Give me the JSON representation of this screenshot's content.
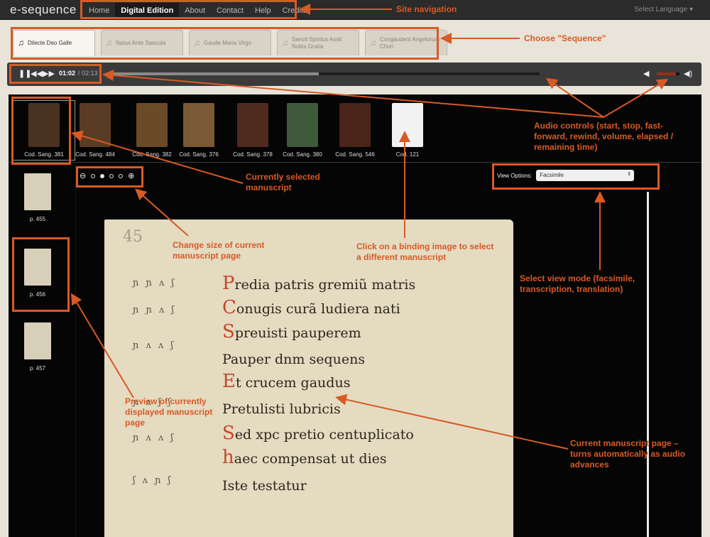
{
  "brand": "e-sequence",
  "nav": [
    "Home",
    "Digital Edition",
    "About",
    "Contact",
    "Help",
    "Credits"
  ],
  "nav_active": "Digital Edition",
  "language": "Select Language",
  "tabs": [
    {
      "label": "Dilecte Deo Galle",
      "active": true
    },
    {
      "label": "Natus Ante Saecula",
      "active": false
    },
    {
      "label": "Gaude Maria Virgo",
      "active": false
    },
    {
      "label": "Sancti Spiritus Assit Nobis Gratia",
      "active": false
    },
    {
      "label": "Congaudent Angelorum Chori",
      "active": false
    }
  ],
  "audio": {
    "elapsed": "01:02",
    "total": "/ 02:13",
    "progress": 0.49,
    "volume": 0.85
  },
  "manuscripts": [
    {
      "label": "Cod. Sang. 381",
      "color": "#4a3220",
      "selected": true
    },
    {
      "label": "Cod. Sang. 484",
      "color": "#5a3c24"
    },
    {
      "label": "Cod. Sang. 382",
      "color": "#6b4a2a"
    },
    {
      "label": "Cod. Sang. 376",
      "color": "#7a5a36"
    },
    {
      "label": "Cod. Sang. 378",
      "color": "#4f2b1d"
    },
    {
      "label": "Cod. Sang. 380",
      "color": "#3f5a3a"
    },
    {
      "label": "Cod. Sang. 546",
      "color": "#4a2418"
    },
    {
      "label": "Cod. 121",
      "color": "#f2f2f2"
    }
  ],
  "pages": [
    {
      "label": "p. 455"
    },
    {
      "label": "p. 456",
      "selected": true
    },
    {
      "label": "p. 457"
    }
  ],
  "view_options": {
    "label": "View Options:",
    "value": "Facsimile"
  },
  "manuscript_page": {
    "number": "45",
    "lines": [
      {
        "initial": "P",
        "text": "redia patris gremiũ matris"
      },
      {
        "initial": "C",
        "text": "onugis curã ludiera nati"
      },
      {
        "initial": "S",
        "text": "preuisti pauperem"
      },
      {
        "initial": "",
        "text": "Pauper dnm sequens"
      },
      {
        "initial": "E",
        "text": "t crucem gaudus"
      },
      {
        "initial": "",
        "text": "Pretulisti lubricis"
      },
      {
        "initial": "S",
        "text": "ed xpc pretio centuplicato"
      },
      {
        "initial": "h",
        "text": "aec compensat ut dies"
      },
      {
        "initial": "",
        "text": "Iste testatur"
      }
    ]
  },
  "annotations": {
    "site_nav": "Site navigation",
    "choose_seq": "Choose \"Sequence\"",
    "audio": "Audio controls (start, stop, fast-forward, rewind, volume, elapsed / remaining time)",
    "selected_ms": "Currently selected manuscript",
    "click_binding": "Click on a binding image to select a different manuscript",
    "change_size": "Change size of current manuscript page",
    "view_mode": "Select view mode (facsimile, transcription, translation)",
    "preview": "Preview of currently displayed manuscript page",
    "current_page": "Current manuscript page – turns automatically as audio advances"
  },
  "accent_color": "#d85a26"
}
